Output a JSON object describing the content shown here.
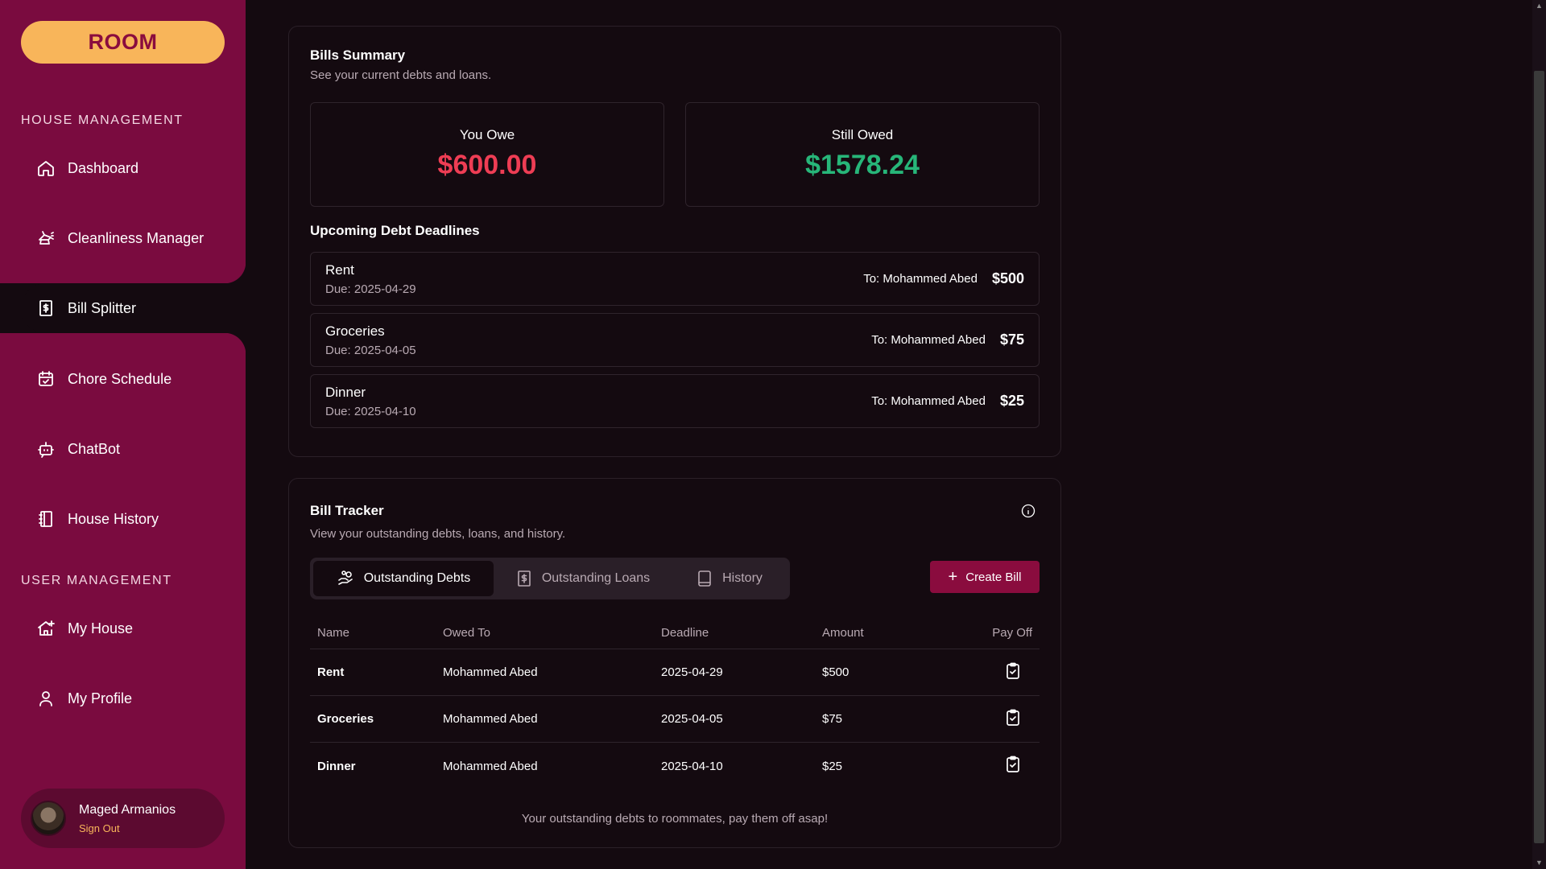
{
  "app": {
    "logo": "ROOM"
  },
  "sidebar": {
    "house_section": "HOUSE MANAGEMENT",
    "user_section": "USER MANAGEMENT",
    "items": [
      {
        "label": "Dashboard",
        "icon": "home-icon"
      },
      {
        "label": "Cleanliness Manager",
        "icon": "spray-icon"
      },
      {
        "label": "Bill Splitter",
        "icon": "receipt-dollar-icon"
      },
      {
        "label": "Chore Schedule",
        "icon": "calendar-check-icon"
      },
      {
        "label": "ChatBot",
        "icon": "bot-icon"
      },
      {
        "label": "House History",
        "icon": "notebook-icon"
      },
      {
        "label": "My House",
        "icon": "house-plus-icon"
      },
      {
        "label": "My Profile",
        "icon": "user-icon"
      }
    ],
    "active": "Bill Splitter",
    "user": {
      "name": "Maged Armanios",
      "sign_out": "Sign Out"
    }
  },
  "summary": {
    "title": "Bills Summary",
    "subtitle": "See your current debts and loans.",
    "you_owe_label": "You Owe",
    "you_owe_value": "$600.00",
    "still_owed_label": "Still Owed",
    "still_owed_value": "$1578.24",
    "deadlines_title": "Upcoming Debt Deadlines",
    "deadlines": [
      {
        "name": "Rent",
        "due": "Due: 2025-04-29",
        "to": "To: Mohammed Abed",
        "amount": "$500"
      },
      {
        "name": "Groceries",
        "due": "Due: 2025-04-05",
        "to": "To: Mohammed Abed",
        "amount": "$75"
      },
      {
        "name": "Dinner",
        "due": "Due: 2025-04-10",
        "to": "To: Mohammed Abed",
        "amount": "$25"
      }
    ]
  },
  "tracker": {
    "title": "Bill Tracker",
    "subtitle": "View your outstanding debts, loans, and history.",
    "tabs": [
      {
        "label": "Outstanding Debts",
        "icon": "hand-coins-icon"
      },
      {
        "label": "Outstanding Loans",
        "icon": "receipt-dollar-icon"
      },
      {
        "label": "History",
        "icon": "book-icon"
      }
    ],
    "active_tab": "Outstanding Debts",
    "create_label": "Create Bill",
    "columns": [
      "Name",
      "Owed To",
      "Deadline",
      "Amount",
      "Pay Off"
    ],
    "rows": [
      {
        "name": "Rent",
        "owed_to": "Mohammed Abed",
        "deadline": "2025-04-29",
        "amount": "$500"
      },
      {
        "name": "Groceries",
        "owed_to": "Mohammed Abed",
        "deadline": "2025-04-05",
        "amount": "$75"
      },
      {
        "name": "Dinner",
        "owed_to": "Mohammed Abed",
        "deadline": "2025-04-10",
        "amount": "$25"
      }
    ],
    "footnote": "Your outstanding debts to roommates, pay them off asap!"
  },
  "colors": {
    "sidebar": "#7a0b3f",
    "accent": "#8a0c3e",
    "logo_bg": "#f8b55a",
    "owe": "#ee3d54",
    "owed": "#27b679"
  }
}
